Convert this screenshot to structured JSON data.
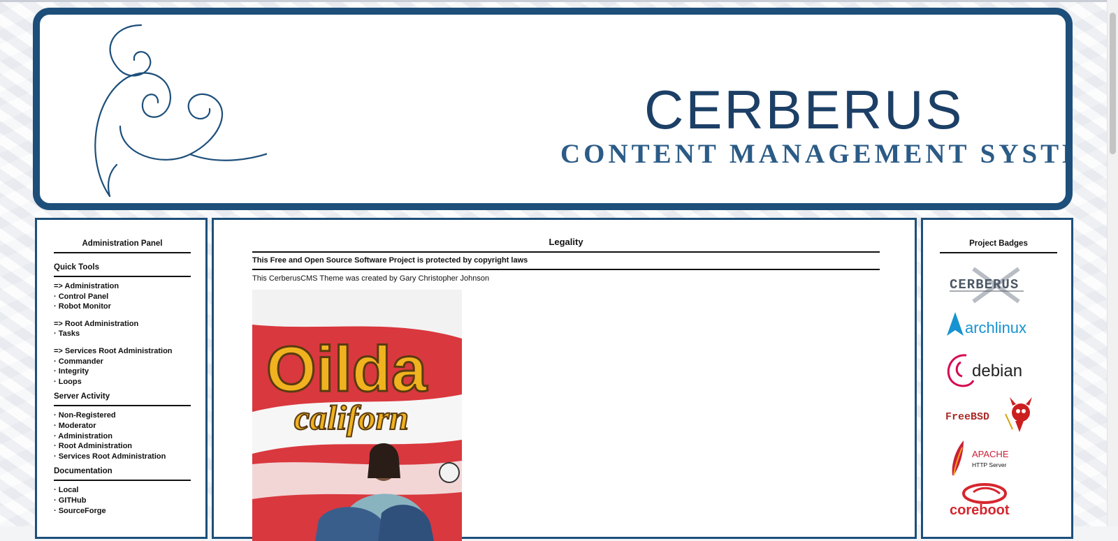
{
  "header": {
    "title": "CERBERUS",
    "subtitle": "CONTENT MANAGEMENT SYSTEM"
  },
  "sidebar": {
    "title": "Administration Panel",
    "sections": [
      {
        "title": "Quick Tools",
        "groups": [
          [
            "=> Administration",
            "· Control Panel",
            "· Robot Monitor"
          ],
          [
            "=> Root Administration",
            "· Tasks"
          ],
          [
            "=> Services Root Administration",
            "· Commander",
            "· Integrity",
            "· Loops"
          ]
        ]
      },
      {
        "title": "Server Activity",
        "groups": [
          [
            "· Non-Registered",
            "· Moderator",
            "· Administration",
            "· Root Administration",
            "· Services Root Administration"
          ]
        ]
      },
      {
        "title": "Documentation",
        "groups": [
          [
            "· Local",
            "· GITHub",
            "· SourceForge"
          ]
        ]
      }
    ]
  },
  "main": {
    "title": "Legality",
    "notice": "This Free and Open Source Software Project is protected by copyright laws",
    "credit": "This CerberusCMS Theme was created by Gary Christopher Johnson",
    "photo_text": [
      "Oilda",
      "californ"
    ]
  },
  "badges": {
    "title": "Project Badges",
    "items": [
      {
        "name": "cerberus-badge",
        "label": "CERBERUS"
      },
      {
        "name": "archlinux-badge",
        "label": "archlinux"
      },
      {
        "name": "debian-badge",
        "label": "debian"
      },
      {
        "name": "freebsd-badge",
        "label": "FreeBSD"
      },
      {
        "name": "apache-badge",
        "label": "APACHE",
        "sublabel": "HTTP Server"
      },
      {
        "name": "coreboot-badge",
        "label": "coreboot"
      }
    ]
  },
  "colors": {
    "frame": "#1d4f7a",
    "brand_title": "#1c3f66",
    "arch_blue": "#1793d1",
    "debian_red": "#d70a53",
    "freebsd_red": "#ab2b28",
    "apache_red": "#c92037",
    "coreboot_red": "#d6262e"
  }
}
